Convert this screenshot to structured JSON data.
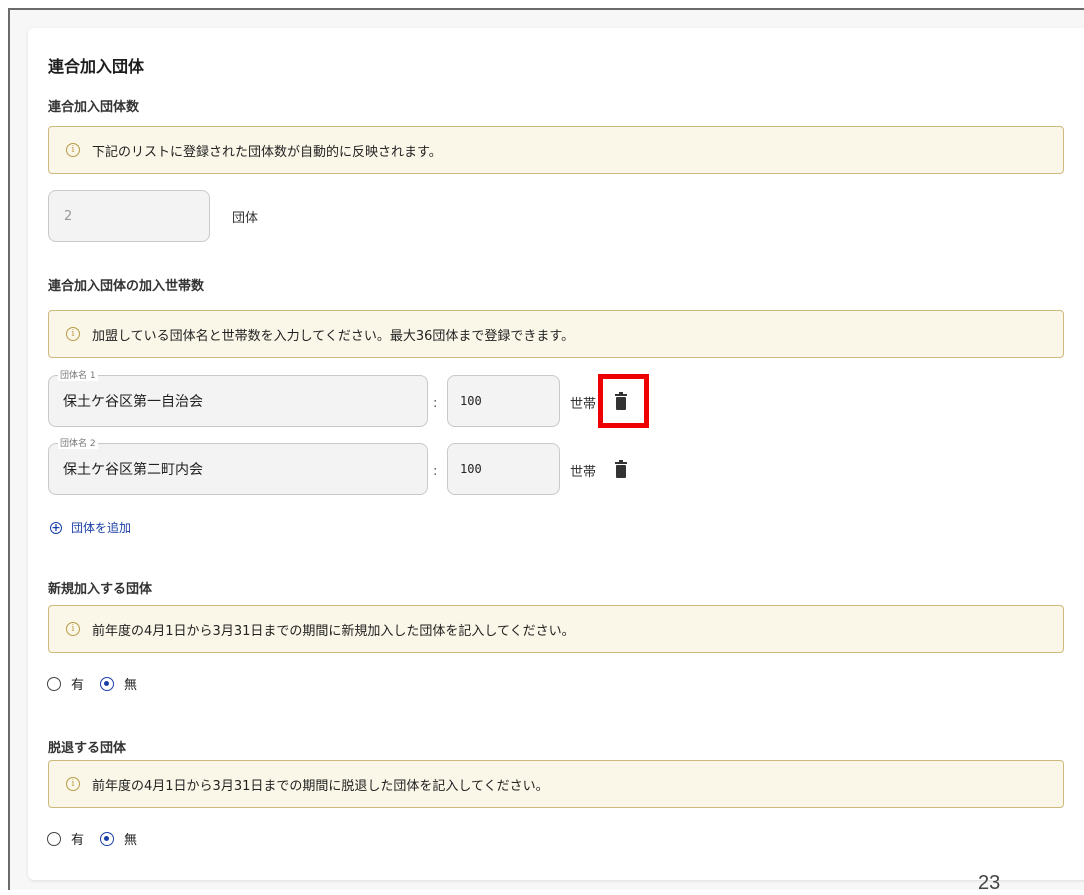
{
  "section": {
    "title": "連合加入団体",
    "group_count": {
      "heading": "連合加入団体数",
      "info": "下記のリストに登録された団体数が自動的に反映されます。",
      "value": "2",
      "unit": "団体"
    },
    "households": {
      "heading": "連合加入団体の加入世帯数",
      "info": "加盟している団体名と世帯数を入力してください。最大36団体まで登録できます。",
      "rows": [
        {
          "label": "団体名 1",
          "name": "保土ケ谷区第一自治会",
          "separator": ":",
          "count": "100",
          "unit": "世帯"
        },
        {
          "label": "団体名 2",
          "name": "保土ケ谷区第二町内会",
          "separator": ":",
          "count": "100",
          "unit": "世帯"
        }
      ],
      "add_label": "団体を追加"
    },
    "new_join": {
      "heading": "新規加入する団体",
      "info": "前年度の4月1日から3月31日までの期間に新規加入した団体を記入してください。",
      "options": [
        {
          "label": "有",
          "selected": false
        },
        {
          "label": "無",
          "selected": true
        }
      ]
    },
    "withdraw": {
      "heading": "脱退する団体",
      "info": "前年度の4月1日から3月31日までの期間に脱退した団体を記入してください。",
      "options": [
        {
          "label": "有",
          "selected": false
        },
        {
          "label": "無",
          "selected": true
        }
      ]
    }
  },
  "page_number": "23",
  "colors": {
    "accent": "#1b3fa6",
    "info_bg": "#fbf7e8",
    "info_border": "#cdb97c",
    "highlight": "#ee0000"
  },
  "icons": [
    "info-icon",
    "trash-icon",
    "add-circle-icon"
  ]
}
